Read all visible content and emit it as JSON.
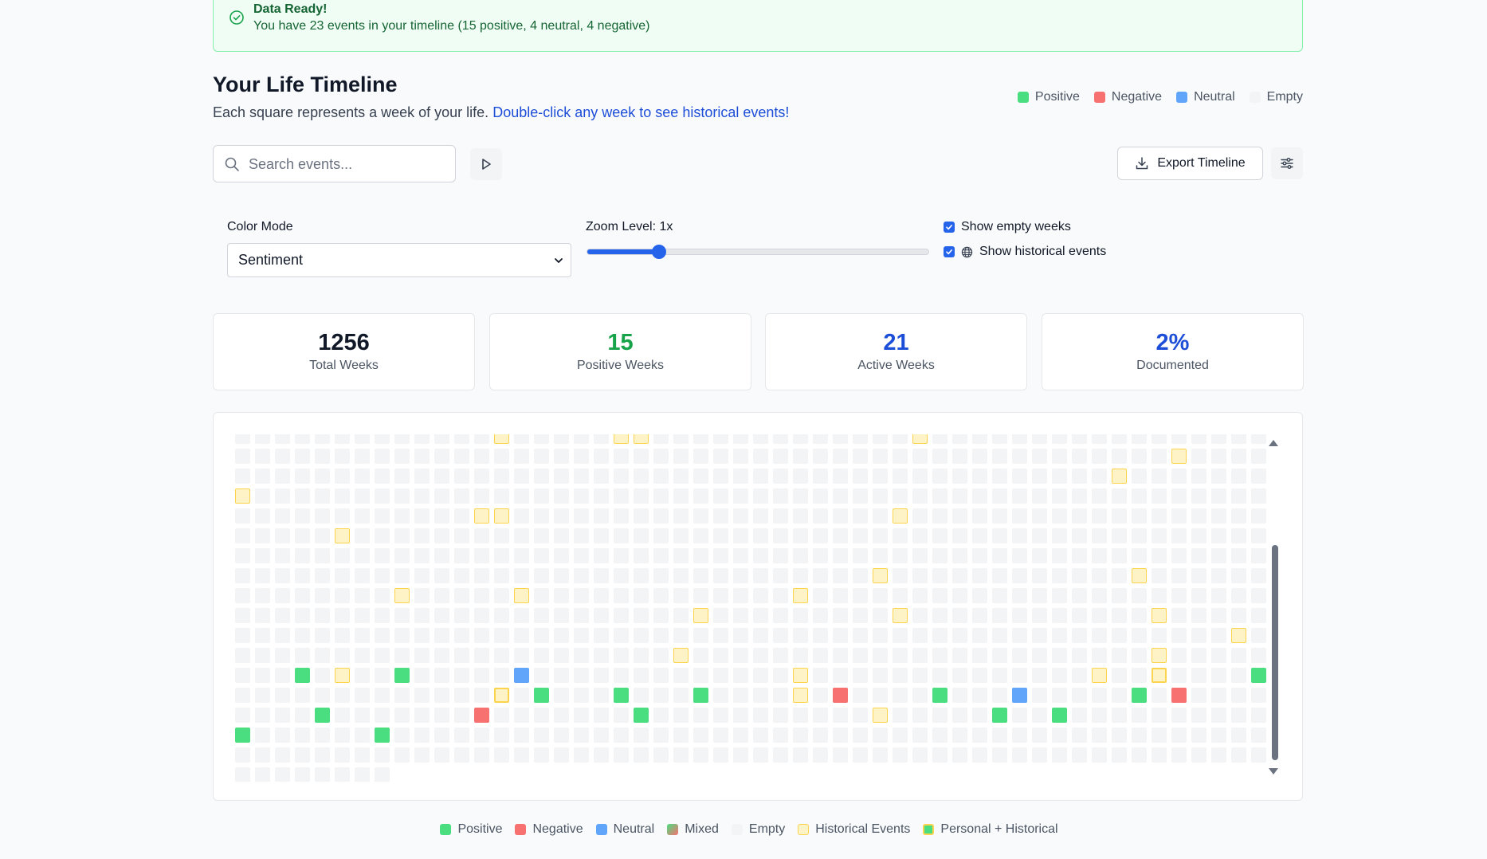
{
  "alert": {
    "title": "Data Ready!",
    "message": "You have 23 events in your timeline (15 positive, 4 neutral, 4 negative)"
  },
  "header": {
    "title": "Your Life Timeline",
    "subtitle": "Each square represents a week of your life.",
    "hint": "Double-click any week to see historical events!"
  },
  "top_legend": [
    {
      "label": "Positive",
      "color": "#4ade80"
    },
    {
      "label": "Negative",
      "color": "#f87171"
    },
    {
      "label": "Neutral",
      "color": "#60a5fa"
    },
    {
      "label": "Empty",
      "color": "#f3f4f6"
    }
  ],
  "toolbar": {
    "search_placeholder": "Search events...",
    "export_label": "Export Timeline"
  },
  "controls": {
    "color_mode_label": "Color Mode",
    "color_mode_value": "Sentiment",
    "zoom_label": "Zoom Level: 1x",
    "zoom_fraction": 0.21,
    "show_empty_label": "Show empty weeks",
    "show_empty_checked": true,
    "show_historical_label": "Show historical events",
    "show_historical_checked": true
  },
  "stats": [
    {
      "value": "1256",
      "label": "Total Weeks",
      "color": "#111827"
    },
    {
      "value": "15",
      "label": "Positive Weeks",
      "color": "#16a34a"
    },
    {
      "value": "21",
      "label": "Active Weeks",
      "color": "#1d4ed8"
    },
    {
      "value": "2%",
      "label": "Documented",
      "color": "#1d4ed8"
    }
  ],
  "timeline_grid": {
    "rows": 18,
    "columns": 52,
    "last_row_filled_weeks": 8,
    "weeks": [
      {
        "row": 0,
        "col": 13,
        "type": "historical"
      },
      {
        "row": 0,
        "col": 19,
        "type": "historical"
      },
      {
        "row": 0,
        "col": 20,
        "type": "historical"
      },
      {
        "row": 0,
        "col": 34,
        "type": "historical"
      },
      {
        "row": 1,
        "col": 47,
        "type": "historical"
      },
      {
        "row": 2,
        "col": 44,
        "type": "historical"
      },
      {
        "row": 3,
        "col": 0,
        "type": "historical"
      },
      {
        "row": 4,
        "col": 12,
        "type": "historical"
      },
      {
        "row": 4,
        "col": 13,
        "type": "historical"
      },
      {
        "row": 4,
        "col": 33,
        "type": "historical"
      },
      {
        "row": 5,
        "col": 5,
        "type": "historical"
      },
      {
        "row": 7,
        "col": 32,
        "type": "historical"
      },
      {
        "row": 7,
        "col": 45,
        "type": "historical"
      },
      {
        "row": 8,
        "col": 8,
        "type": "historical"
      },
      {
        "row": 8,
        "col": 14,
        "type": "historical"
      },
      {
        "row": 8,
        "col": 28,
        "type": "historical"
      },
      {
        "row": 9,
        "col": 23,
        "type": "historical"
      },
      {
        "row": 9,
        "col": 33,
        "type": "historical"
      },
      {
        "row": 9,
        "col": 46,
        "type": "historical"
      },
      {
        "row": 10,
        "col": 50,
        "type": "historical"
      },
      {
        "row": 11,
        "col": 22,
        "type": "historical"
      },
      {
        "row": 11,
        "col": 46,
        "type": "historical"
      },
      {
        "row": 12,
        "col": 3,
        "type": "positive"
      },
      {
        "row": 12,
        "col": 5,
        "type": "historical"
      },
      {
        "row": 12,
        "col": 8,
        "type": "positive"
      },
      {
        "row": 12,
        "col": 14,
        "type": "neutral"
      },
      {
        "row": 12,
        "col": 28,
        "type": "historical"
      },
      {
        "row": 12,
        "col": 43,
        "type": "historical"
      },
      {
        "row": 12,
        "col": 46,
        "type": "positive+historical"
      },
      {
        "row": 12,
        "col": 51,
        "type": "positive"
      },
      {
        "row": 13,
        "col": 13,
        "type": "negative+historical"
      },
      {
        "row": 13,
        "col": 15,
        "type": "positive"
      },
      {
        "row": 13,
        "col": 19,
        "type": "positive"
      },
      {
        "row": 13,
        "col": 23,
        "type": "positive"
      },
      {
        "row": 13,
        "col": 28,
        "type": "historical"
      },
      {
        "row": 13,
        "col": 30,
        "type": "negative"
      },
      {
        "row": 13,
        "col": 35,
        "type": "positive"
      },
      {
        "row": 13,
        "col": 39,
        "type": "neutral"
      },
      {
        "row": 13,
        "col": 45,
        "type": "positive"
      },
      {
        "row": 13,
        "col": 47,
        "type": "negative"
      },
      {
        "row": 14,
        "col": 4,
        "type": "positive"
      },
      {
        "row": 14,
        "col": 12,
        "type": "negative"
      },
      {
        "row": 14,
        "col": 20,
        "type": "positive"
      },
      {
        "row": 14,
        "col": 32,
        "type": "historical"
      },
      {
        "row": 14,
        "col": 38,
        "type": "positive"
      },
      {
        "row": 14,
        "col": 41,
        "type": "positive"
      },
      {
        "row": 15,
        "col": 0,
        "type": "positive"
      },
      {
        "row": 15,
        "col": 7,
        "type": "positive"
      }
    ]
  },
  "bottom_legend": [
    {
      "label": "Positive",
      "swatch": "positive"
    },
    {
      "label": "Negative",
      "swatch": "negative"
    },
    {
      "label": "Neutral",
      "swatch": "neutral"
    },
    {
      "label": "Mixed",
      "swatch": "mixed"
    },
    {
      "label": "Empty",
      "swatch": "empty"
    },
    {
      "label": "Historical Events",
      "swatch": "historical"
    },
    {
      "label": "Personal + Historical",
      "swatch": "personal-historical"
    }
  ]
}
